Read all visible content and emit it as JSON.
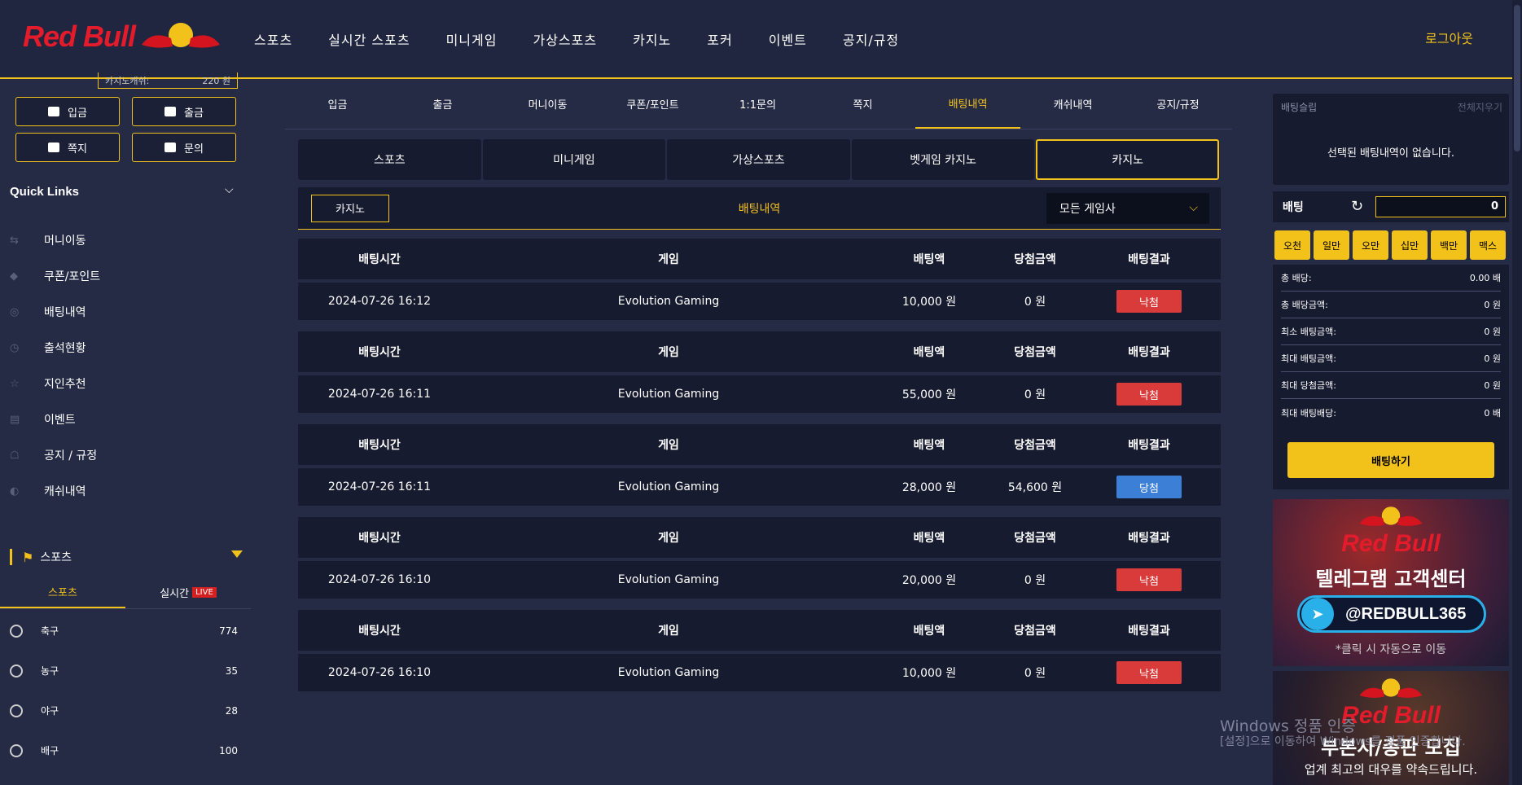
{
  "header": {
    "logo_text": "Red Bull",
    "nav": [
      "스포츠",
      "실시간 스포츠",
      "미니게임",
      "가상스포츠",
      "카지노",
      "포커",
      "이벤트",
      "공지/규정"
    ],
    "logout": "로그아웃"
  },
  "sidebar": {
    "balance_label": "카지노캐쉬:",
    "balance_value": "220 원",
    "buttons": {
      "deposit": "입금",
      "withdraw": "출금",
      "message": "쪽지",
      "inquiry": "문의"
    },
    "quick_links_title": "Quick Links",
    "quick_links": [
      "머니이동",
      "쿠폰/포인트",
      "배팅내역",
      "출석현황",
      "지인추천",
      "이벤트",
      "공지 / 규정",
      "캐쉬내역"
    ],
    "sports_title": "스포츠",
    "sports_tabs": {
      "sports": "스포츠",
      "live_label": "실시간",
      "live_badge": "LIVE"
    },
    "sports": [
      {
        "name": "축구",
        "count": "774"
      },
      {
        "name": "농구",
        "count": "35"
      },
      {
        "name": "야구",
        "count": "28"
      },
      {
        "name": "배구",
        "count": "100"
      }
    ]
  },
  "main": {
    "subtabs": [
      "입금",
      "출금",
      "머니이동",
      "쿠폰/포인트",
      "1:1문의",
      "쪽지",
      "배팅내역",
      "캐쉬내역",
      "공지/규정"
    ],
    "active_subtab": "배팅내역",
    "category_tabs": [
      "스포츠",
      "미니게임",
      "가상스포츠",
      "벳게임 카지노",
      "카지노"
    ],
    "active_category": "카지노",
    "filter": {
      "casino_button": "카지노",
      "title": "배팅내역",
      "select_value": "모든 게임사"
    },
    "columns": {
      "time": "배팅시간",
      "game": "게임",
      "amount": "배팅액",
      "win": "당첨금액",
      "result": "배팅결과"
    },
    "bets": [
      {
        "time": "2024-07-26 16:12",
        "game": "Evolution Gaming",
        "amount": "10,000 원",
        "win": "0 원",
        "result": "낙첨",
        "status": "lose"
      },
      {
        "time": "2024-07-26 16:11",
        "game": "Evolution Gaming",
        "amount": "55,000 원",
        "win": "0 원",
        "result": "낙첨",
        "status": "lose"
      },
      {
        "time": "2024-07-26 16:11",
        "game": "Evolution Gaming",
        "amount": "28,000 원",
        "win": "54,600 원",
        "result": "당첨",
        "status": "win"
      },
      {
        "time": "2024-07-26 16:10",
        "game": "Evolution Gaming",
        "amount": "20,000 원",
        "win": "0 원",
        "result": "낙첨",
        "status": "lose"
      },
      {
        "time": "2024-07-26 16:10",
        "game": "Evolution Gaming",
        "amount": "10,000 원",
        "win": "0 원",
        "result": "낙첨",
        "status": "lose"
      }
    ]
  },
  "right": {
    "slip_title": "배팅슬립",
    "slip_clear": "전체지우기",
    "slip_empty": "선택된 배팅내역이 없습니다.",
    "bet_label": "배팅",
    "bet_amount": "0",
    "quick_amounts": [
      "오천",
      "일만",
      "오만",
      "십만",
      "백만",
      "맥스"
    ],
    "totals": [
      {
        "label": "총 배당:",
        "value": "0.00 배"
      },
      {
        "label": "총 배당금액:",
        "value": "0 원"
      },
      {
        "label": "최소 배팅금액:",
        "value": "0 원"
      },
      {
        "label": "최대 배팅금액:",
        "value": "0 원"
      },
      {
        "label": "최대 당첨금액:",
        "value": "0 원"
      },
      {
        "label": "최대 배팅배당:",
        "value": "0 배"
      }
    ],
    "bet_button": "배팅하기",
    "banner1": {
      "logo": "Red Bull",
      "title": "텔레그램 고객센터",
      "handle": "@REDBULL365",
      "note": "*클릭 시 자동으로 이동"
    },
    "banner2": {
      "logo": "Red Bull",
      "title": "부본사/총판 모집",
      "sub": "업계 최고의 대우를 약속드립니다."
    }
  },
  "watermark": {
    "line1": "Windows 정품 인증",
    "line2": "[설정]으로 이동하여 Windows를 정품 인증합니다."
  },
  "colors": {
    "accent": "#f2c21a",
    "background": "#252b45",
    "panel": "#171b30",
    "lose": "#d93a3a",
    "win": "#3b7fd6",
    "brand_red": "#e31b2b"
  }
}
